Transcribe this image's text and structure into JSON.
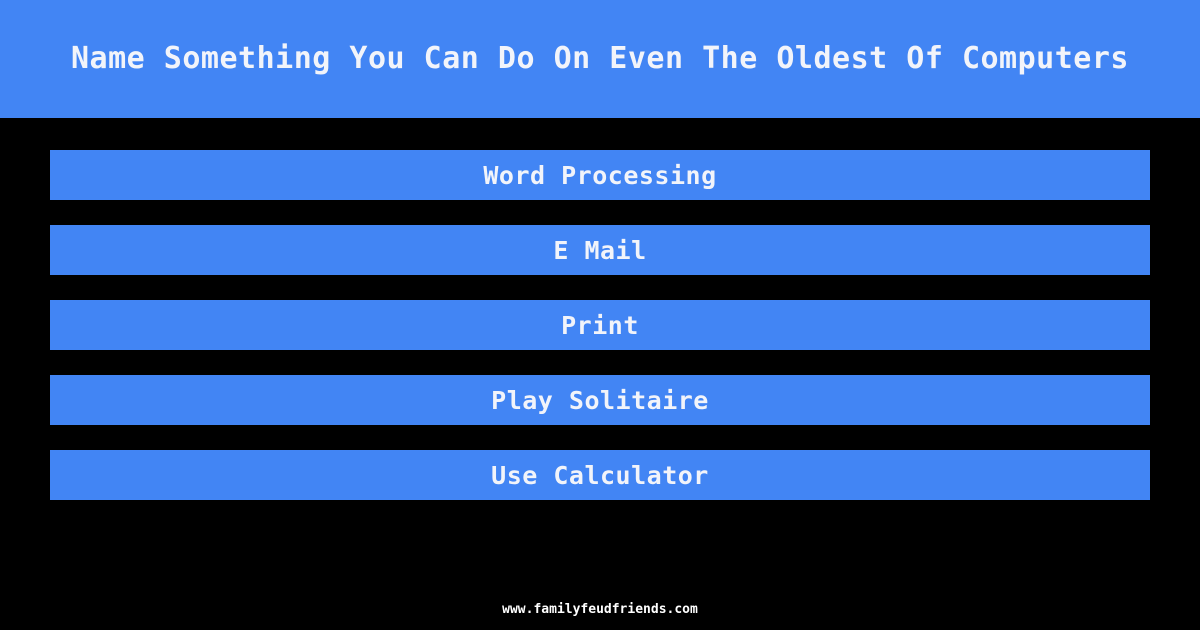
{
  "theme": {
    "background_color": "#000000",
    "accent_color": "#4285f4",
    "text_color": "#f2f4fa",
    "footer_text_color": "#ffffff"
  },
  "header": {
    "question": "Name Something You Can Do On Even The Oldest Of Computers"
  },
  "answers": [
    {
      "rank": 1,
      "label": "Word Processing"
    },
    {
      "rank": 2,
      "label": "E Mail"
    },
    {
      "rank": 3,
      "label": "Print"
    },
    {
      "rank": 4,
      "label": "Play Solitaire"
    },
    {
      "rank": 5,
      "label": "Use Calculator"
    }
  ],
  "footer": {
    "site": "www.familyfeudfriends.com"
  }
}
